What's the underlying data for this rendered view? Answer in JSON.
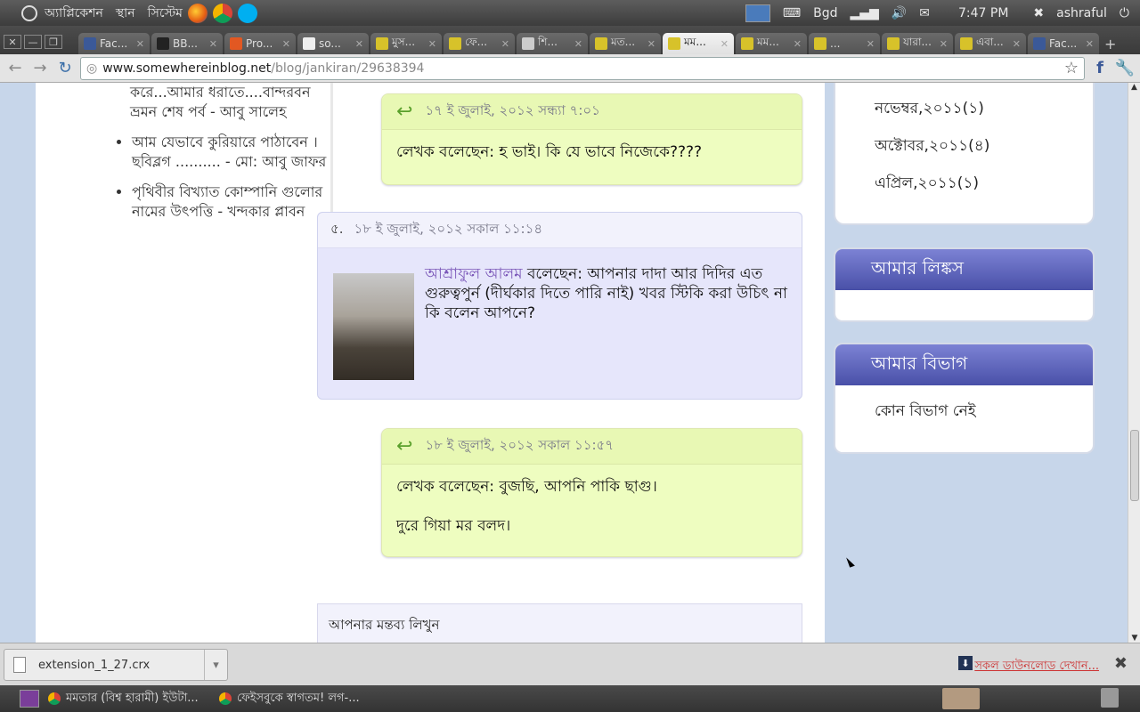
{
  "topPanel": {
    "menus": [
      "অ্যাপ্লিকেশন",
      "স্থান",
      "সিস্টেম"
    ],
    "layout": "Bgd",
    "time": "7:47 PM",
    "user": "ashraful"
  },
  "tabs": [
    {
      "label": "Fac...",
      "color": "#3b5998"
    },
    {
      "label": "BB...",
      "color": "#222222"
    },
    {
      "label": "Pro...",
      "color": "#e25822"
    },
    {
      "label": "so...",
      "color": "#eeeeee"
    },
    {
      "label": "মুস...",
      "color": "#d7c22a"
    },
    {
      "label": "ফে...",
      "color": "#d7c22a"
    },
    {
      "label": "শি...",
      "color": "#cccccc"
    },
    {
      "label": "মত...",
      "color": "#d7c22a"
    },
    {
      "label": "মম...",
      "color": "#d7c22a",
      "active": true
    },
    {
      "label": "মম...",
      "color": "#d7c22a"
    },
    {
      "label": "...",
      "color": "#d7c22a"
    },
    {
      "label": "যারা...",
      "color": "#d7c22a"
    },
    {
      "label": "এবা...",
      "color": "#d7c22a"
    },
    {
      "label": "Fac...",
      "color": "#3b5998"
    }
  ],
  "address": {
    "host": "www.somewhereinblog.net",
    "path": "/blog/jankiran/29638394"
  },
  "leftSidebar": {
    "firstItem": "করে...আমার ধরাতে....বান্দরবন ভ্রমন শেষ পর্ব - আবু সালেহ",
    "items": [
      "আম যেভাবে কুরিয়ারে পাঠাবেন । ছবিব্লগ .......... - মো: আবু জাফর",
      "পৃথিবীর বিখ্যাত কোম্পানি গুলোর নামের উৎপত্তি - খন্দকার প্লাবন"
    ]
  },
  "replies": [
    {
      "date": "১৭ ই জুলাই, ২০১২ সন্ধ্যা ৭:০১",
      "lines": [
        "লেখক বলেছেন: হ ভাই। কি যে ভাবে নিজেকে????"
      ]
    },
    {
      "date": "১৮ ই জুলাই, ২০১২ সকাল ১১:৫৭",
      "lines": [
        "লেখক বলেছেন: বুজছি, আপনি পাকি ছাগু।",
        "দুরে গিয়া মর বলদ।"
      ]
    }
  ],
  "comment": {
    "number": "৫.",
    "date": "১৮ ই জুলাই, ২০১২ সকাল ১১:১৪",
    "author": "আশ্রাফুল আলম",
    "text": " বলেছেন: আপনার দাদা আর দিদির এত গুরুত্বপুর্ন (দীর্ঘকার দিতে পারি নাই) খবর স্টিকি করা উচিৎ না কি বলেন আপনে?"
  },
  "writeComment": {
    "label": "আপনার মন্তব্য লিখুন"
  },
  "archive": [
    "নভেম্বর,২০১১(১)",
    "অক্টোবর,২০১১(৪)",
    "এপ্রিল,২০১১(১)"
  ],
  "widgets": {
    "links_title": "আমার লিঙ্কস",
    "category_title": "আমার বিভাগ",
    "category_empty": "কোন বিভাগ নেই"
  },
  "downloads": {
    "file": "extension_1_27.crx",
    "show_all": "সকল ডাউনলোড দেখান..."
  },
  "taskbar": [
    "মমতার (বিশ্ব হারামী) ইউটা...",
    "ফেইসবুকে স্বাগতম! লগ-..."
  ]
}
